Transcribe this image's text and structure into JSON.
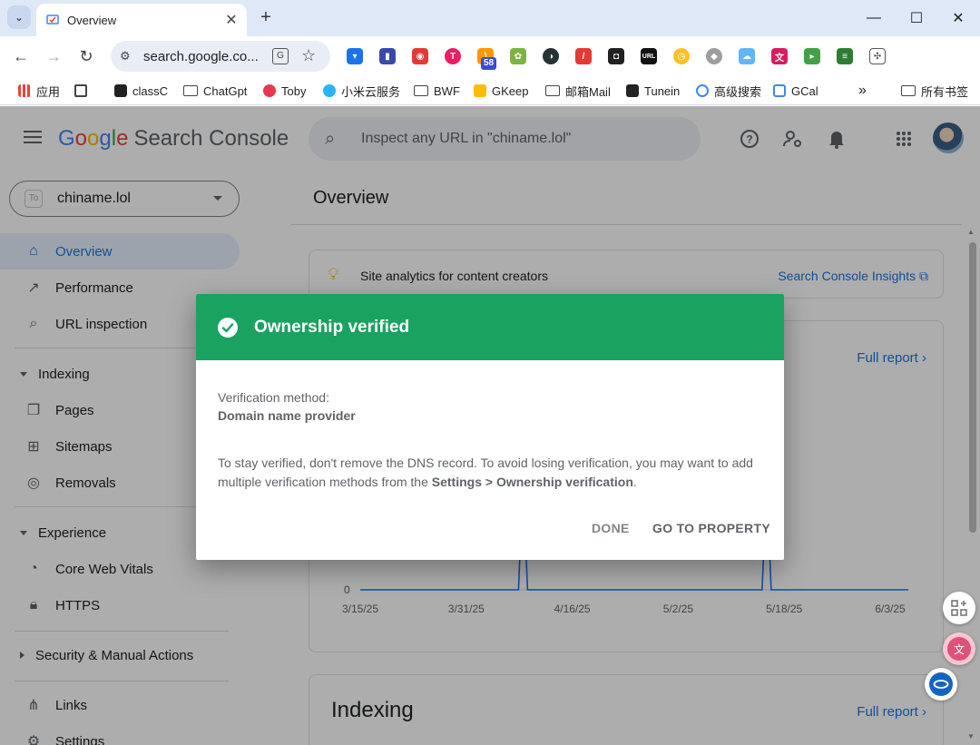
{
  "browser": {
    "tab": {
      "title": "Overview"
    },
    "omnibox": {
      "url": "search.google.co..."
    },
    "extensions": {
      "badge": "58",
      "url_ext": "URL"
    },
    "bookmarks": [
      {
        "label": "应用"
      },
      {
        "label": ""
      },
      {
        "label": "classC"
      },
      {
        "label": "ChatGpt"
      },
      {
        "label": "Toby"
      },
      {
        "label": "小米云服务"
      },
      {
        "label": "BWF"
      },
      {
        "label": "GKeep"
      },
      {
        "label": "邮箱Mail"
      },
      {
        "label": "Tunein"
      },
      {
        "label": "高级搜索"
      },
      {
        "label": "GCal"
      }
    ],
    "bookmarks_more": "»",
    "all_bookmarks": "所有书签"
  },
  "header": {
    "logo_google": [
      "G",
      "o",
      "o",
      "g",
      "l",
      "e"
    ],
    "logo_product": "Search Console",
    "search_placeholder": "Inspect any URL in \"chiname.lol\""
  },
  "sidebar": {
    "property": "chiname.lol",
    "items": [
      {
        "label": "Overview",
        "icon": "home-icon",
        "active": true
      },
      {
        "label": "Performance",
        "icon": "trending-icon"
      },
      {
        "label": "URL inspection",
        "icon": "search-icon"
      }
    ],
    "sections": [
      {
        "label": "Indexing",
        "items": [
          {
            "label": "Pages"
          },
          {
            "label": "Sitemaps"
          },
          {
            "label": "Removals"
          }
        ]
      },
      {
        "label": "Experience",
        "items": [
          {
            "label": "Core Web Vitals"
          },
          {
            "label": "HTTPS"
          }
        ]
      },
      {
        "label": "Security & Manual Actions",
        "items": []
      }
    ],
    "bottom_items": [
      {
        "label": "Links"
      },
      {
        "label": "Settings"
      }
    ]
  },
  "main": {
    "title": "Overview",
    "insight_text": "Site analytics for content creators",
    "insight_link": "Search Console Insights",
    "full_report": "Full report",
    "indexing_title": "Indexing"
  },
  "chart_data": {
    "type": "line",
    "x": [
      "3/15/25",
      "3/31/25",
      "4/16/25",
      "5/2/25",
      "5/18/25",
      "6/3/25"
    ],
    "y_tick_visible": "0",
    "series": [
      {
        "values": [
          0,
          0,
          0,
          0,
          0,
          0
        ]
      }
    ],
    "spikes_at": [
      "~4/12/25",
      "~5/19/25"
    ],
    "color": "#1a73e8"
  },
  "dialog": {
    "title": "Ownership verified",
    "method_label": "Verification method:",
    "method_value": "Domain name provider",
    "body_prefix": "To stay verified, don't remove the DNS record. To avoid losing verification, you may want to add multiple verification methods from the ",
    "body_bold": "Settings > Ownership verification",
    "body_suffix": ".",
    "done": "DONE",
    "go": "GO TO PROPERTY",
    "header_color": "#1aa260"
  }
}
